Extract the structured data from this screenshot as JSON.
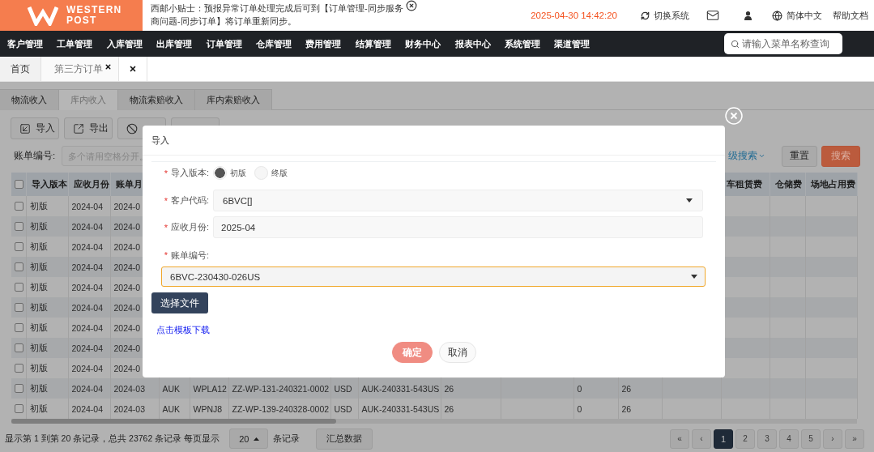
{
  "header": {
    "logo": {
      "line_1": "WESTERN",
      "line_2": "POST"
    },
    "notice": "西邮小贴士：预报异常订单处理完成后可到【订单管理-同步服务商问题-同步订单】将订单重新同步。",
    "datetime": "2025-04-30 14:42:20",
    "links": [
      {
        "kind": "switch_system",
        "label": "切换系统"
      },
      {
        "kind": "mail"
      },
      {
        "kind": "user"
      },
      {
        "kind": "language",
        "label": "简体中文"
      },
      {
        "kind": "help",
        "label": "帮助文档"
      }
    ]
  },
  "nav": {
    "items": [
      "客户管理",
      "工单管理",
      "入库管理",
      "出库管理",
      "订单管理",
      "仓库管理",
      "费用管理",
      "结算管理",
      "财务中心",
      "报表中心",
      "系统管理",
      "渠道管理"
    ],
    "search": {
      "placeholder": "请输入菜单名称查询"
    }
  },
  "page_tabs": [
    {
      "label": "首页",
      "selected": false,
      "closable": false
    },
    {
      "label": "第三方订单",
      "selected": true,
      "closable": true
    }
  ],
  "sub_tabs": [
    {
      "label": "物流收入",
      "selected": false
    },
    {
      "label": "库内收入",
      "selected": true
    },
    {
      "label": "物流索赔收入",
      "selected": false
    },
    {
      "label": "库内索赔收入",
      "selected": false
    }
  ],
  "toolbar": [
    {
      "kind": "import",
      "label": "导入"
    },
    {
      "kind": "export",
      "label": "导出"
    },
    {
      "kind": "void"
    },
    {
      "kind": "other"
    }
  ],
  "filter": {
    "label": "账单编号:",
    "placeholder": "多个请用空格分开。",
    "advanced_link": "级搜索",
    "buttons": [
      {
        "kind": "reset",
        "label": "重置"
      },
      {
        "kind": "search",
        "label": "搜索"
      }
    ]
  },
  "table": {
    "select_all_checked": false,
    "columns": [
      "导入版本",
      "应收月份",
      "账单月",
      null,
      null,
      null,
      null,
      null,
      null,
      null,
      null,
      null,
      null,
      "车租赁费",
      "仓储费",
      "场地占用费"
    ],
    "rows": [
      {
        "checked": false,
        "cells": [
          "初版",
          "2024-04",
          "2024-0"
        ]
      },
      {
        "checked": false,
        "cells": [
          "初版",
          "2024-04",
          "2024-0"
        ]
      },
      {
        "checked": false,
        "cells": [
          "初版",
          "2024-04",
          "2024-0"
        ]
      },
      {
        "checked": false,
        "cells": [
          "初版",
          "2024-04",
          "2024-0"
        ]
      },
      {
        "checked": false,
        "cells": [
          "初版",
          "2024-04",
          "2024-0"
        ]
      },
      {
        "checked": false,
        "cells": [
          "初版",
          "2024-04",
          "2024-0"
        ]
      },
      {
        "checked": false,
        "cells": [
          "初版",
          "2024-04",
          "2024-0"
        ]
      },
      {
        "checked": false,
        "cells": [
          "初版",
          "2024-04",
          "2024-0"
        ]
      },
      {
        "checked": false,
        "cells": [
          "初版",
          "2024-04",
          "2024-0"
        ]
      },
      {
        "checked": false,
        "cells": [
          "初版",
          "2024-04",
          "2024-03",
          "AUK",
          "WPLA12",
          "ZZ-WP-131-240321-0002",
          "USD",
          "AUK-240331-543US",
          "26",
          null,
          "0",
          "26"
        ]
      },
      {
        "checked": false,
        "cells": [
          "初版",
          "2024-04",
          "2024-03",
          "AUK",
          "WPNJ8",
          "ZZ-WP-139-240328-0002",
          "USD",
          "AUK-240331-543US",
          "26",
          null,
          "0",
          "26"
        ]
      }
    ]
  },
  "pagination": {
    "summary": "显示第 1 到第 20 条记录，总共 23762 条记录 每页显示",
    "page_size": "20",
    "suffix": "条记录",
    "summary_button": "汇总数据",
    "pages": [
      {
        "label": "«",
        "selected": false
      },
      {
        "label": "‹",
        "selected": false
      },
      {
        "label": "1",
        "selected": true
      },
      {
        "label": "2",
        "selected": false
      },
      {
        "label": "3",
        "selected": false
      },
      {
        "label": "4",
        "selected": false
      },
      {
        "label": "5",
        "selected": false
      },
      {
        "label": "›",
        "selected": false
      },
      {
        "label": "»",
        "selected": false
      }
    ]
  },
  "modal": {
    "title": "导入",
    "fields": [
      {
        "kind": "radio",
        "required_mark": "*",
        "label": "导入版本:",
        "options": [
          {
            "label": "初版",
            "selected": true
          },
          {
            "label": "终版",
            "selected": false
          }
        ]
      },
      {
        "kind": "select",
        "required_mark": "*",
        "label": "客户代码:",
        "value": "6BVC[]"
      },
      {
        "kind": "input",
        "required_mark": "*",
        "label": "应收月份:",
        "value": "2025-04"
      },
      {
        "kind": "stacked_select",
        "required_mark": "*",
        "label": "账单编号:",
        "value": "6BVC-230430-026US",
        "focused": true
      }
    ],
    "file_button": "选择文件",
    "template_link": "点击模板下载",
    "buttons": [
      {
        "kind": "confirm",
        "label": "确定"
      },
      {
        "kind": "cancel",
        "label": "取消"
      }
    ]
  }
}
